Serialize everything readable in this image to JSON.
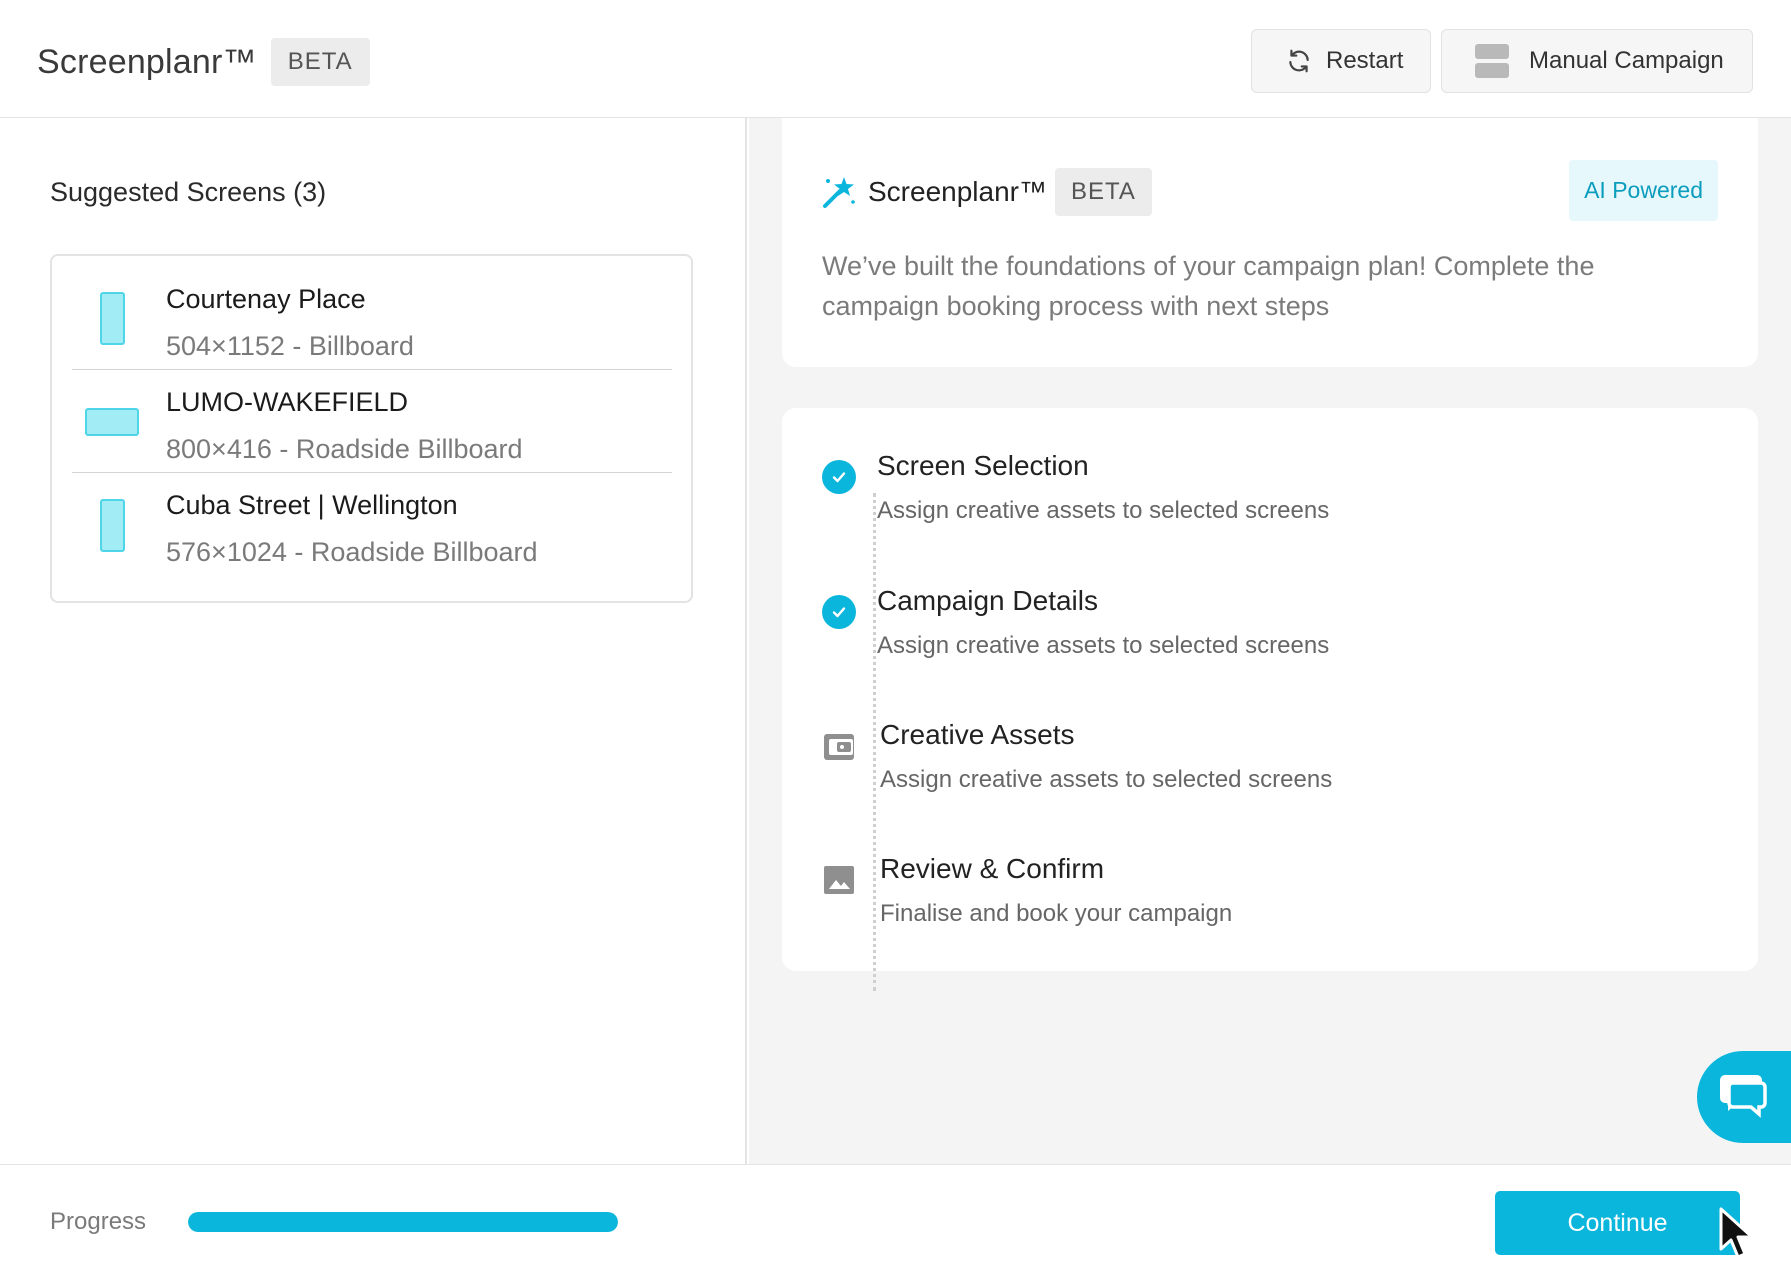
{
  "header": {
    "brand": "Screenplanr™",
    "beta": "BETA",
    "restart_label": "Restart",
    "manual_campaign_label": "Manual Campaign"
  },
  "suggested": {
    "title": "Suggested Screens (3)",
    "screens": [
      {
        "name": "Courtenay Place",
        "meta": "504×1152 - Billboard",
        "orientation": "portrait"
      },
      {
        "name": "LUMO-WAKEFIELD",
        "meta": "800×416 - Roadside Billboard",
        "orientation": "landscape"
      },
      {
        "name": "Cuba Street | Wellington",
        "meta": "576×1024 - Roadside Billboard",
        "orientation": "portrait"
      }
    ]
  },
  "intro": {
    "title": "Screenplanr™",
    "beta": "BETA",
    "ai_badge": "AI Powered",
    "text": "We’ve built the foundations of your campaign plan! Complete the campaign booking process with next steps"
  },
  "steps": [
    {
      "title": "Screen Selection",
      "desc": "Assign creative assets to selected screens",
      "status": "complete",
      "icon": "check-circle-icon"
    },
    {
      "title": "Campaign Details",
      "desc": "Assign creative assets to selected screens",
      "status": "complete",
      "icon": "check-circle-icon"
    },
    {
      "title": "Creative Assets",
      "desc": "Assign creative assets to selected screens",
      "status": "pending",
      "icon": "wallet-icon"
    },
    {
      "title": "Review & Confirm",
      "desc": "Finalise and book your campaign",
      "status": "pending",
      "icon": "image-icon"
    }
  ],
  "footer": {
    "progress_label": "Progress",
    "progress_fraction": 1.0,
    "continue_label": "Continue"
  },
  "colors": {
    "accent": "#0bb6dc",
    "screen_thumb_fill": "#a2ecf5",
    "screen_thumb_border": "#4ed6e8",
    "ai_badge_bg": "#e6f8fb",
    "ai_badge_text": "#0b9dbd"
  },
  "icons": {
    "restart": "refresh-icon",
    "manual_campaign": "layout-blocks-icon",
    "intro": "magic-wand-icon",
    "chat": "chat-bubbles-icon",
    "cursor": "mouse-pointer-icon"
  }
}
